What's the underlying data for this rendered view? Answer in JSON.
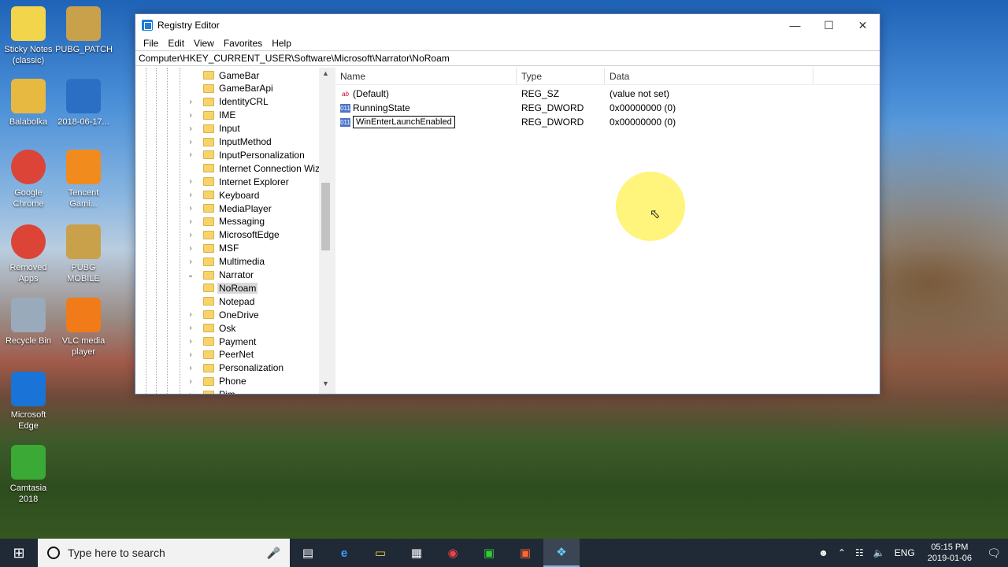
{
  "desktop": {
    "icons": [
      {
        "label": "Sticky Notes (classic)",
        "icon": "sticky-notes-icon"
      },
      {
        "label": "PUBG_PATCH",
        "icon": "pubg-icon"
      },
      {
        "label": "Balabolka",
        "icon": "balabolka-icon"
      },
      {
        "label": "2018-06-17...",
        "icon": "image-file-icon"
      },
      {
        "label": "Google Chrome",
        "icon": "chrome-icon"
      },
      {
        "label": "Tencent Gami...",
        "icon": "tencent-icon"
      },
      {
        "label": "Removed Apps",
        "icon": "chrome-icon"
      },
      {
        "label": "PUBG MOBILE",
        "icon": "pubg-icon"
      },
      {
        "label": "Recycle Bin",
        "icon": "recycle-bin-icon"
      },
      {
        "label": "VLC media player",
        "icon": "vlc-icon"
      },
      {
        "label": "Microsoft Edge",
        "icon": "edge-icon"
      },
      {
        "label": "Camtasia 2018",
        "icon": "camtasia-icon"
      }
    ]
  },
  "window": {
    "title": "Registry Editor",
    "menu": [
      "File",
      "Edit",
      "View",
      "Favorites",
      "Help"
    ],
    "address": "Computer\\HKEY_CURRENT_USER\\Software\\Microsoft\\Narrator\\NoRoam",
    "tree": [
      {
        "label": "GameBar",
        "expander": ""
      },
      {
        "label": "GameBarApi",
        "expander": ""
      },
      {
        "label": "IdentityCRL",
        "expander": "›"
      },
      {
        "label": "IME",
        "expander": "›"
      },
      {
        "label": "Input",
        "expander": "›"
      },
      {
        "label": "InputMethod",
        "expander": "›"
      },
      {
        "label": "InputPersonalization",
        "expander": "›"
      },
      {
        "label": "Internet Connection Wizard",
        "expander": ""
      },
      {
        "label": "Internet Explorer",
        "expander": "›"
      },
      {
        "label": "Keyboard",
        "expander": "›"
      },
      {
        "label": "MediaPlayer",
        "expander": "›"
      },
      {
        "label": "Messaging",
        "expander": "›"
      },
      {
        "label": "MicrosoftEdge",
        "expander": "›"
      },
      {
        "label": "MSF",
        "expander": "›"
      },
      {
        "label": "Multimedia",
        "expander": "›"
      },
      {
        "label": "Narrator",
        "expander": "⌄"
      },
      {
        "label": "NoRoam",
        "expander": "",
        "child": true,
        "selected": true
      },
      {
        "label": "Notepad",
        "expander": ""
      },
      {
        "label": "OneDrive",
        "expander": "›"
      },
      {
        "label": "Osk",
        "expander": "›"
      },
      {
        "label": "Payment",
        "expander": "›"
      },
      {
        "label": "PeerNet",
        "expander": "›"
      },
      {
        "label": "Personalization",
        "expander": "›"
      },
      {
        "label": "Phone",
        "expander": "›"
      },
      {
        "label": "Pim",
        "expander": "›"
      }
    ],
    "columns": {
      "name": "Name",
      "type": "Type",
      "data": "Data"
    },
    "values": [
      {
        "name": "(Default)",
        "type": "REG_SZ",
        "data": "(value not set)",
        "kind": "sz"
      },
      {
        "name": "RunningState",
        "type": "REG_DWORD",
        "data": "0x00000000 (0)",
        "kind": "dw"
      },
      {
        "name": "WinEnterLaunchEnabled",
        "type": "REG_DWORD",
        "data": "0x00000000 (0)",
        "kind": "dw",
        "editing": true
      }
    ]
  },
  "taskbar": {
    "search_placeholder": "Type here to search",
    "language": "ENG",
    "time": "05:15 PM",
    "date": "2019-01-06"
  }
}
